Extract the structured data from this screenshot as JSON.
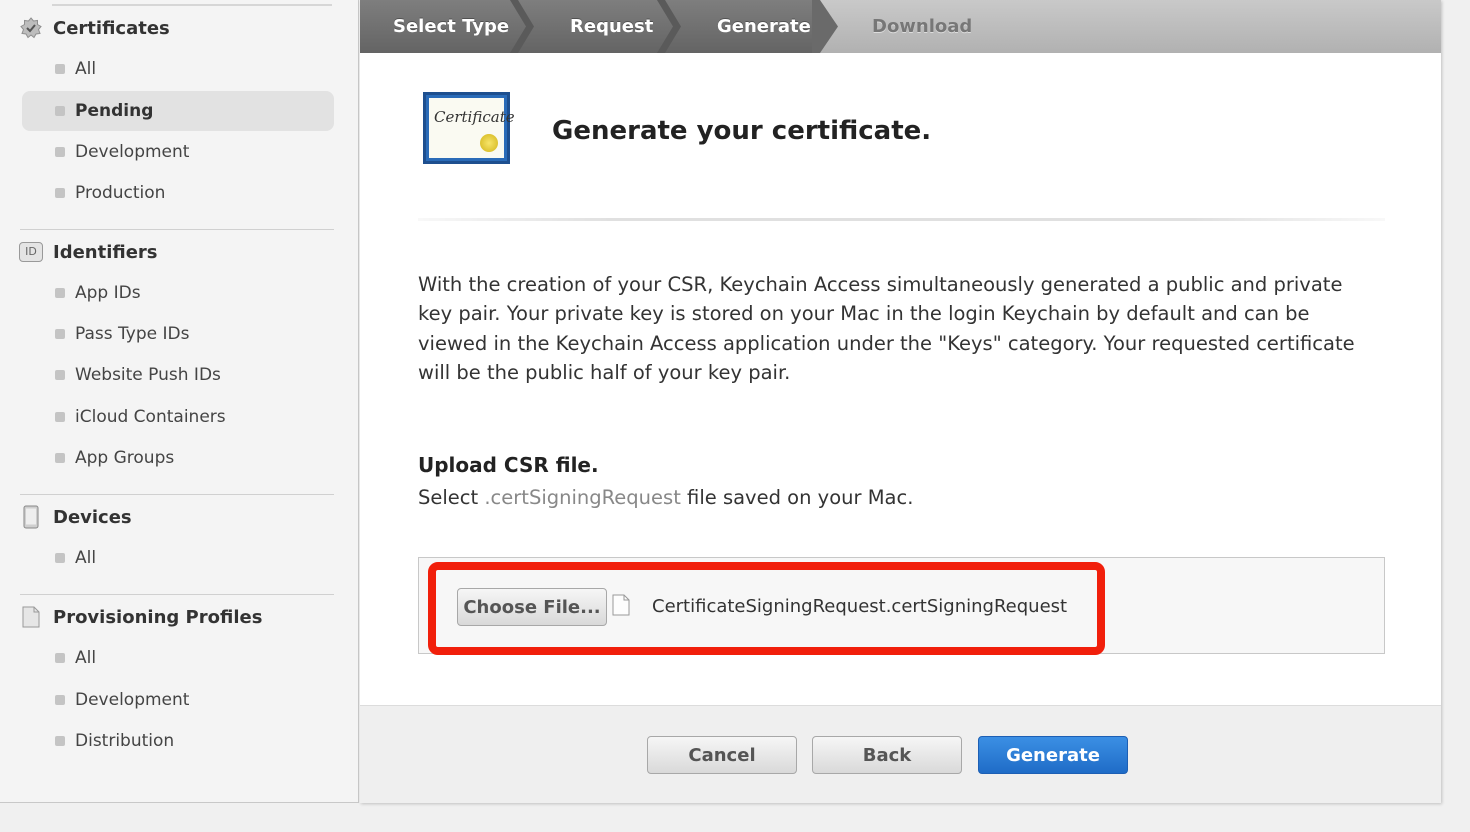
{
  "sidebar": {
    "sections": [
      {
        "title": "Certificates",
        "icon": "certificate-badge-icon",
        "items": [
          {
            "label": "All"
          },
          {
            "label": "Pending",
            "active": true
          },
          {
            "label": "Development"
          },
          {
            "label": "Production"
          }
        ]
      },
      {
        "title": "Identifiers",
        "icon": "id-icon",
        "icon_text": "ID",
        "items": [
          {
            "label": "App IDs"
          },
          {
            "label": "Pass Type IDs"
          },
          {
            "label": "Website Push IDs"
          },
          {
            "label": "iCloud Containers"
          },
          {
            "label": "App Groups"
          }
        ]
      },
      {
        "title": "Devices",
        "icon": "device-icon",
        "items": [
          {
            "label": "All"
          }
        ]
      },
      {
        "title": "Provisioning Profiles",
        "icon": "document-icon",
        "items": [
          {
            "label": "All"
          },
          {
            "label": "Development"
          },
          {
            "label": "Distribution"
          }
        ]
      }
    ]
  },
  "steps": [
    "Select Type",
    "Request",
    "Generate",
    "Download"
  ],
  "main": {
    "cert_icon_text": "Certificate",
    "title": "Generate your certificate.",
    "description": "With the creation of your CSR, Keychain Access simultaneously generated a public and private key pair. Your private key is stored on your Mac in the login Keychain by default and can be viewed in the Keychain Access application under the \"Keys\" category. Your requested certificate will be the public half of your key pair.",
    "upload_title": "Upload CSR file.",
    "upload_sub_before": "Select ",
    "upload_sub_ext": ".certSigningRequest",
    "upload_sub_after": " file saved on your Mac.",
    "choose_file_label": "Choose File...",
    "file_name": "CertificateSigningRequest.certSigningRequest",
    "highlight_color": "#f11f0b"
  },
  "footer": {
    "cancel_label": "Cancel",
    "back_label": "Back",
    "generate_label": "Generate"
  },
  "colors": {
    "accent": "#1f6cc7"
  }
}
